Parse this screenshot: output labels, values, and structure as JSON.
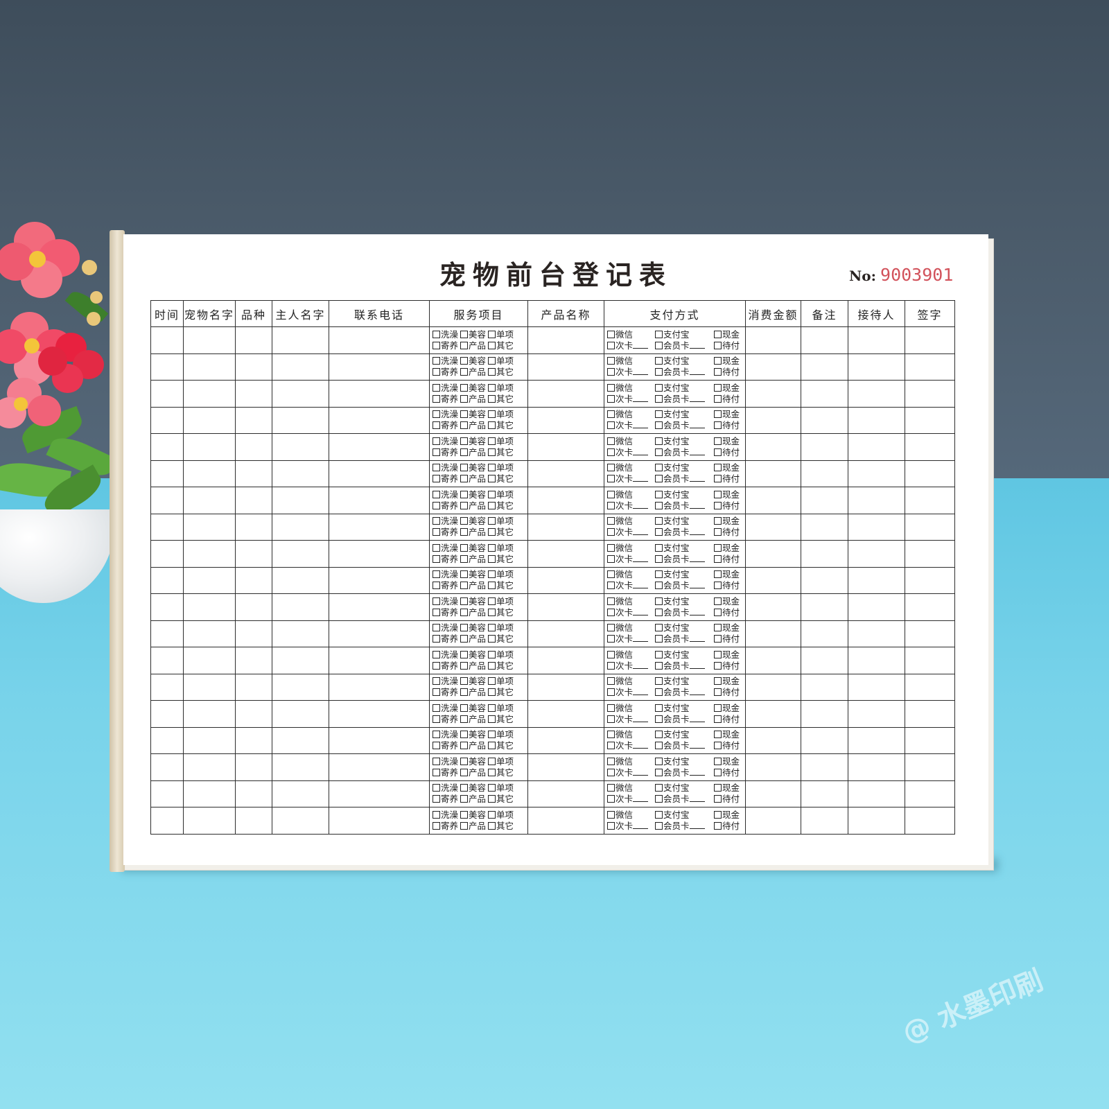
{
  "form": {
    "title": "宠物前台登记表",
    "serial_label": "No:",
    "serial_number": "9003901",
    "columns": [
      "时间",
      "宠物名字",
      "品种",
      "主人名字",
      "联系电话",
      "服务项目",
      "产品名称",
      "支付方式",
      "消费金额",
      "备注",
      "接待人",
      "签字"
    ],
    "service_options_line1": [
      "洗澡",
      "美容",
      "单项"
    ],
    "service_options_line2": [
      "寄养",
      "产品",
      "其它"
    ],
    "payment_options_line1": [
      "微信",
      "支付宝",
      "现金"
    ],
    "payment_options_line2": [
      "次卡",
      "会员卡",
      "待付"
    ],
    "row_count": 19
  },
  "watermark": "@ 水墨印刷",
  "colors": {
    "wall": "#46566a",
    "desk": "#78d3ea",
    "serial_red": "#d2525b",
    "ink": "#222222"
  }
}
